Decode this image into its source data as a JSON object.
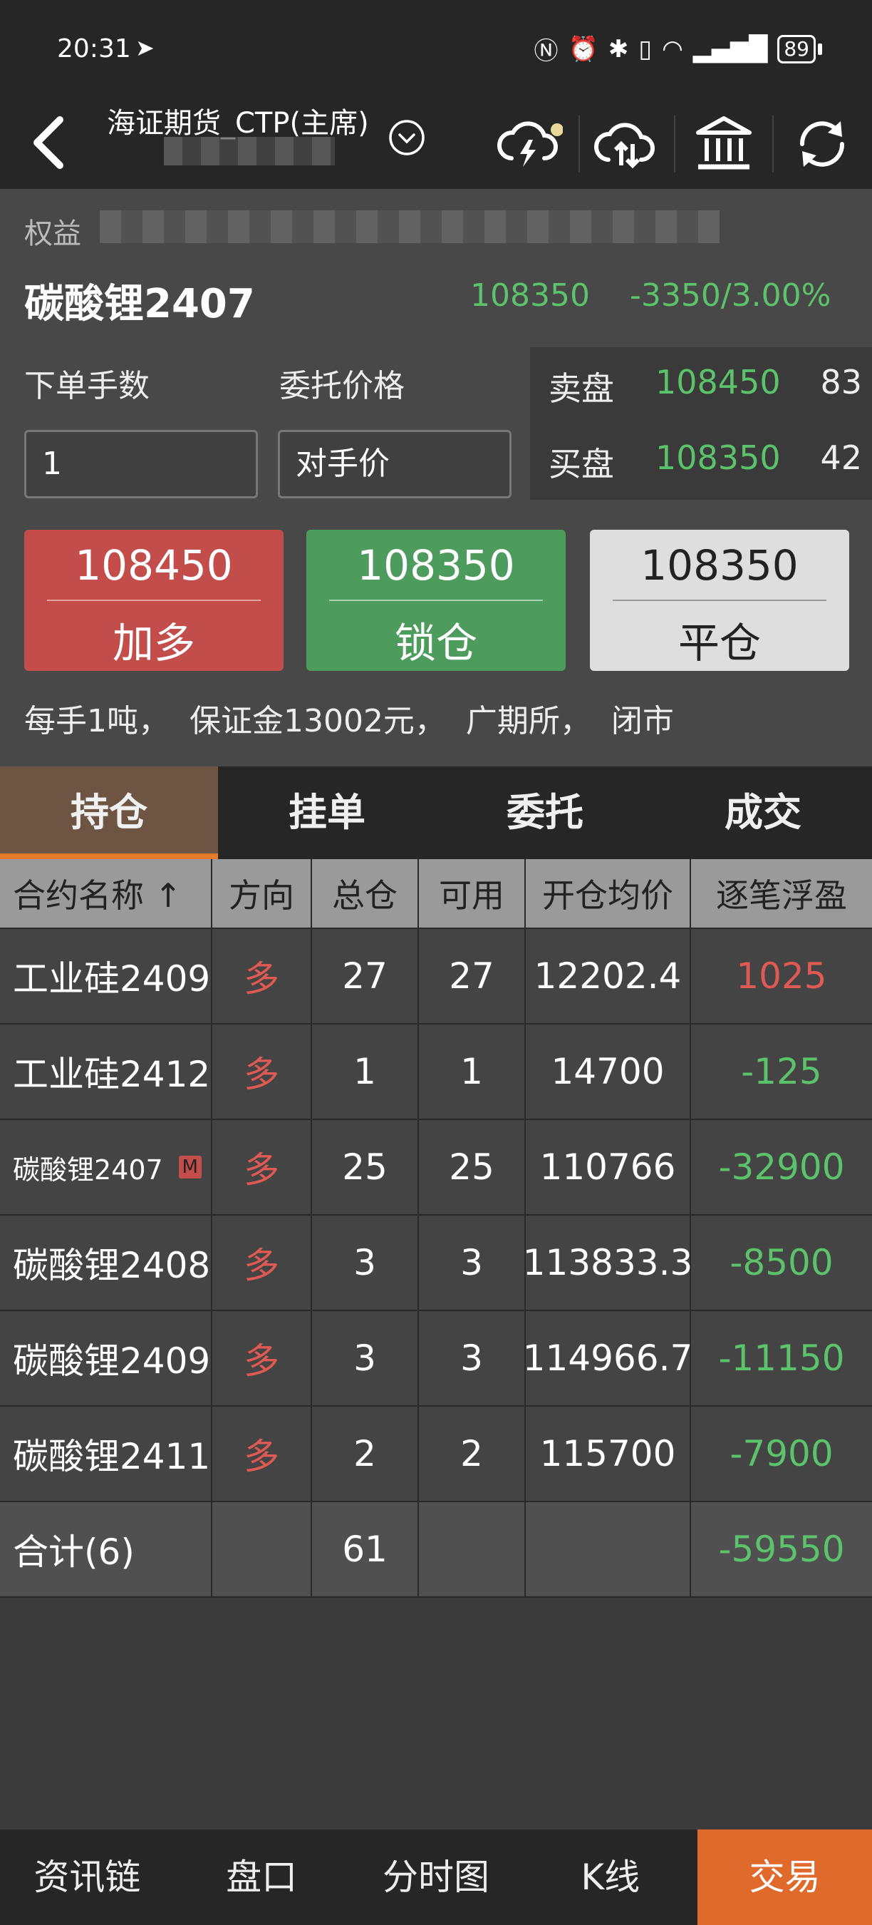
{
  "status_bar": {
    "time": "20:31",
    "battery": "89"
  },
  "header": {
    "account_title": "海证期货_CTP(主席)"
  },
  "account_summary": {
    "label": "权益"
  },
  "contract": {
    "name": "碳酸锂2407",
    "last_price": "108350",
    "change": "-3350/3.00%"
  },
  "order": {
    "qty_label": "下单手数",
    "price_label": "委托价格",
    "qty_value": "1",
    "price_value": "对手价"
  },
  "quote": {
    "ask_label": "卖盘",
    "ask_price": "108450",
    "ask_volume": "83",
    "bid_label": "买盘",
    "bid_price": "108350",
    "bid_volume": "42"
  },
  "buttons": {
    "long": {
      "price": "108450",
      "action": "加多"
    },
    "lock": {
      "price": "108350",
      "action": "锁仓"
    },
    "close": {
      "price": "108350",
      "action": "平仓"
    }
  },
  "info_line": "每手1吨，  保证金13002元，  广期所，  闭市",
  "tabs": [
    "持仓",
    "挂单",
    "委托",
    "成交"
  ],
  "positions": {
    "headers": [
      "合约名称 ↑",
      "方向",
      "总仓",
      "可用",
      "开仓均价",
      "逐笔浮盈"
    ],
    "rows": [
      {
        "name": "工业硅2409",
        "dir": "多",
        "total": "27",
        "avail": "27",
        "avg": "12202.4",
        "pnl": "1025",
        "sign": "pos",
        "badge": ""
      },
      {
        "name": "工业硅2412",
        "dir": "多",
        "total": "1",
        "avail": "1",
        "avg": "14700",
        "pnl": "-125",
        "sign": "neg",
        "badge": ""
      },
      {
        "name": "碳酸锂2407",
        "dir": "多",
        "total": "25",
        "avail": "25",
        "avg": "110766",
        "pnl": "-32900",
        "sign": "neg",
        "badge": "M"
      },
      {
        "name": "碳酸锂2408",
        "dir": "多",
        "total": "3",
        "avail": "3",
        "avg": "113833.3",
        "pnl": "-8500",
        "sign": "neg",
        "badge": ""
      },
      {
        "name": "碳酸锂2409",
        "dir": "多",
        "total": "3",
        "avail": "3",
        "avg": "114966.7",
        "pnl": "-11150",
        "sign": "neg",
        "badge": ""
      },
      {
        "name": "碳酸锂2411",
        "dir": "多",
        "total": "2",
        "avail": "2",
        "avg": "115700",
        "pnl": "-7900",
        "sign": "neg",
        "badge": ""
      }
    ],
    "total": {
      "label": "合计(6)",
      "total": "61",
      "pnl": "-59550"
    }
  },
  "bottom_nav": [
    "资讯链",
    "盘口",
    "分时图",
    "K线",
    "交易"
  ],
  "colors": {
    "up_red": "#e05a55",
    "down_green": "#5cc26b",
    "accent_orange": "#e0692c"
  }
}
